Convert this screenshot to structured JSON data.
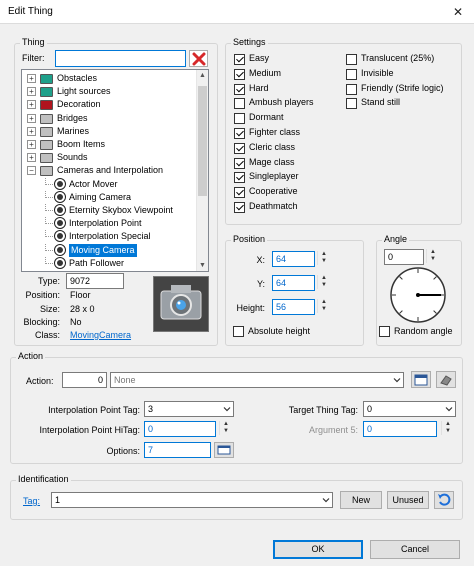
{
  "window": {
    "title": "Edit Thing",
    "close_glyph": "✕"
  },
  "thing_group": {
    "label": "Thing",
    "filter_label": "Filter:",
    "filter_value": "",
    "tree": [
      {
        "label": "Obstacles",
        "folder_color": "#1fa08a",
        "expander": "+"
      },
      {
        "label": "Light sources",
        "folder_color": "#1fa08a",
        "expander": "+"
      },
      {
        "label": "Decoration",
        "folder_color": "#b0141e",
        "expander": "+"
      },
      {
        "label": "Bridges",
        "folder_color": "#c0c0c0",
        "expander": "+"
      },
      {
        "label": "Marines",
        "folder_color": "#c0c0c0",
        "expander": "+"
      },
      {
        "label": "Boom Items",
        "folder_color": "#c0c0c0",
        "expander": "+"
      },
      {
        "label": "Sounds",
        "folder_color": "#c0c0c0",
        "expander": "+"
      },
      {
        "label": "Cameras and Interpolation",
        "folder_color": "#c0c0c0",
        "expander": "−"
      }
    ],
    "tree_children": [
      {
        "label": "Actor Mover",
        "selected": false
      },
      {
        "label": "Aiming Camera",
        "selected": false
      },
      {
        "label": "Eternity Skybox Viewpoint",
        "selected": false
      },
      {
        "label": "Interpolation Point",
        "selected": false
      },
      {
        "label": "Interpolation Special",
        "selected": false
      },
      {
        "label": "Moving Camera",
        "selected": true
      },
      {
        "label": "Path Follower",
        "selected": false
      }
    ],
    "info": {
      "type_label": "Type:",
      "type_value": "9072",
      "position_label": "Position:",
      "position_value": "Floor",
      "size_label": "Size:",
      "size_value": "28 x 0",
      "blocking_label": "Blocking:",
      "blocking_value": "No",
      "class_label": "Class:",
      "class_value": "MovingCamera"
    }
  },
  "settings": {
    "label": "Settings",
    "col1": [
      {
        "label": "Easy",
        "checked": true
      },
      {
        "label": "Medium",
        "checked": true
      },
      {
        "label": "Hard",
        "checked": true
      },
      {
        "label": "Ambush players",
        "checked": false
      },
      {
        "label": "Dormant",
        "checked": false
      },
      {
        "label": "Fighter class",
        "checked": true
      },
      {
        "label": "Cleric class",
        "checked": true
      },
      {
        "label": "Mage class",
        "checked": true
      },
      {
        "label": "Singleplayer",
        "checked": true
      },
      {
        "label": "Cooperative",
        "checked": true
      },
      {
        "label": "Deathmatch",
        "checked": true
      }
    ],
    "col2": [
      {
        "label": "Translucent (25%)",
        "checked": false
      },
      {
        "label": "Invisible",
        "checked": false
      },
      {
        "label": "Friendly (Strife logic)",
        "checked": false
      },
      {
        "label": "Stand still",
        "checked": false
      }
    ]
  },
  "position": {
    "label": "Position",
    "x_label": "X:",
    "x_value": "64",
    "y_label": "Y:",
    "y_value": "64",
    "height_label": "Height:",
    "height_value": "56",
    "absolute_label": "Absolute height"
  },
  "angle": {
    "label": "Angle",
    "value": "0",
    "random_label": "Random angle"
  },
  "action": {
    "label": "Action",
    "action_label": "Action:",
    "action_number": "0",
    "action_name": "None",
    "tag_label": "Interpolation Point Tag:",
    "tag_value": "3",
    "hitag_label": "Interpolation Point HiTag:",
    "hitag_value": "0",
    "options_label": "Options:",
    "options_value": "7",
    "target_label": "Target Thing Tag:",
    "target_value": "0",
    "arg5_label": "Argument 5:",
    "arg5_value": "0"
  },
  "identification": {
    "label": "Identification",
    "tag_link": "Tag:",
    "tag_value": "1",
    "new_label": "New",
    "unused_label": "Unused"
  },
  "footer": {
    "ok_label": "OK",
    "cancel_label": "Cancel"
  }
}
